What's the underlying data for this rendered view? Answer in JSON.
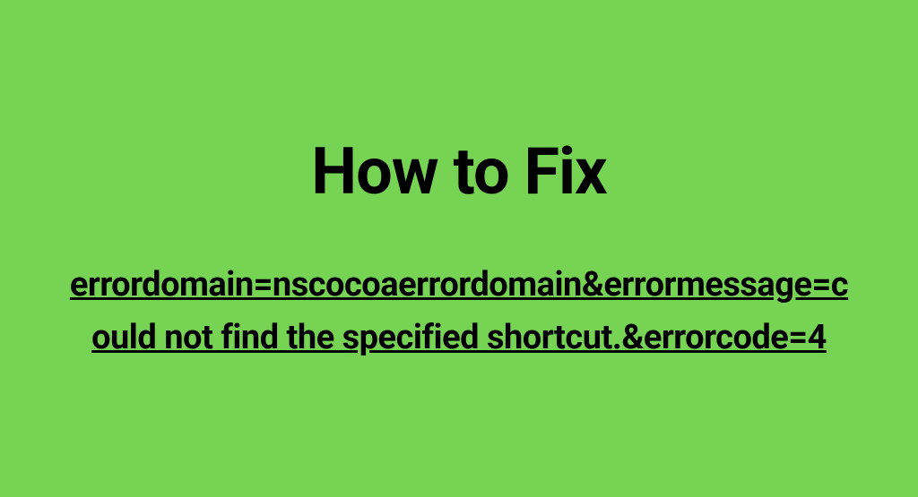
{
  "heading": "How to Fix",
  "error_text": "errordomain=nscocoaerrordomain&errormessage=could not find the specified shortcut.&errorcode=4"
}
